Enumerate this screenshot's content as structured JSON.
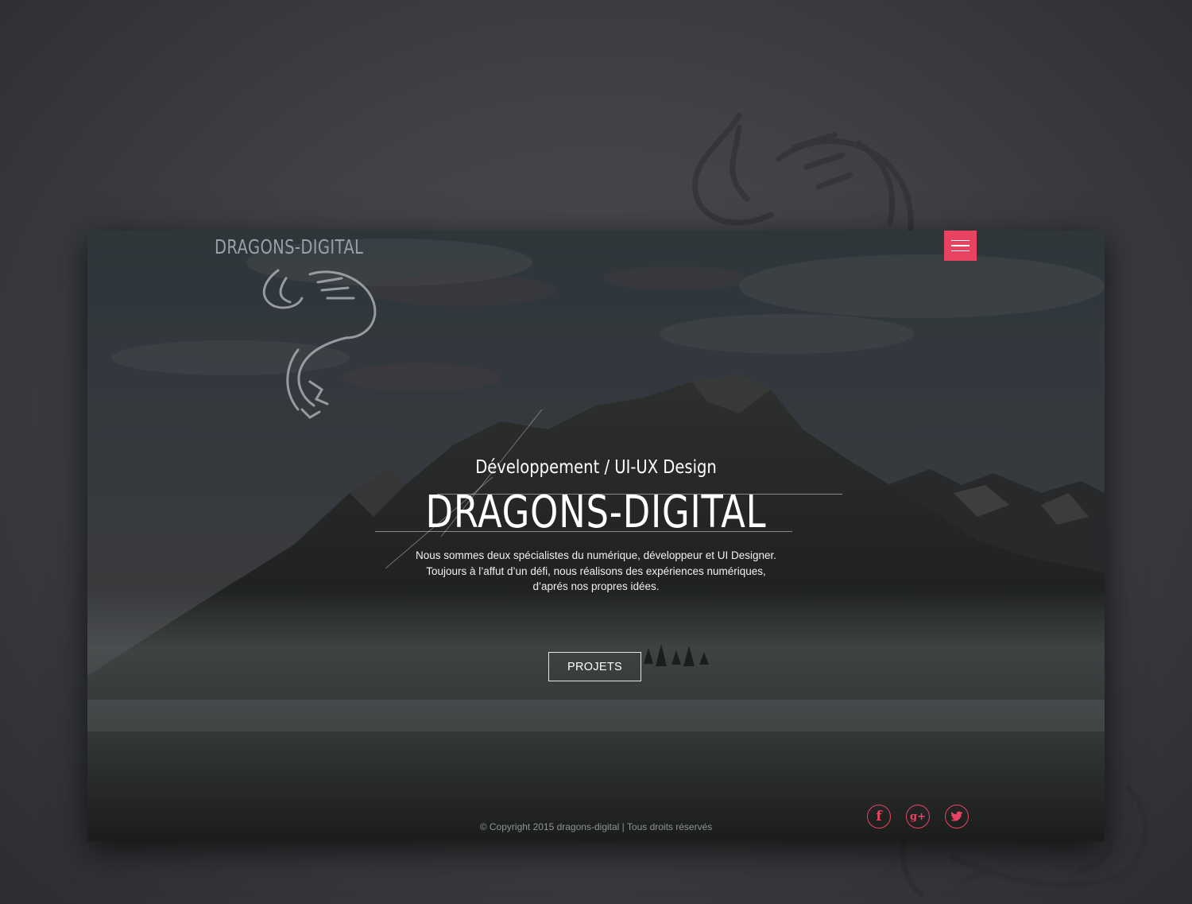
{
  "brand": {
    "logo_text": "DRAGONS-DIGITAL"
  },
  "nav": {
    "menu_icon": "hamburger-icon"
  },
  "hero": {
    "subtitle": "Développement / UI-UX Design",
    "title": "DRAGONS-DIGITAL",
    "description_lines": [
      "Nous sommes deux spécialistes du numérique, développeur et UI Designer.",
      "Toujours à l’affut d’un défi, nous réalisons des expériences numériques,",
      "d’aprés nos propres idées."
    ],
    "cta_label": "PROJETS"
  },
  "footer": {
    "copyright": "© Copyright 2015 dragons-digital | Tous droits réservés",
    "social": [
      {
        "name": "facebook-icon",
        "glyph": "f"
      },
      {
        "name": "google-plus-icon",
        "glyph": "g+"
      },
      {
        "name": "twitter-icon",
        "glyph": ""
      }
    ]
  },
  "colors": {
    "accent": "#e84462",
    "page_bg": "#3f4145",
    "text_light": "#ffffff",
    "logo_grey": "#9aa0a6"
  }
}
